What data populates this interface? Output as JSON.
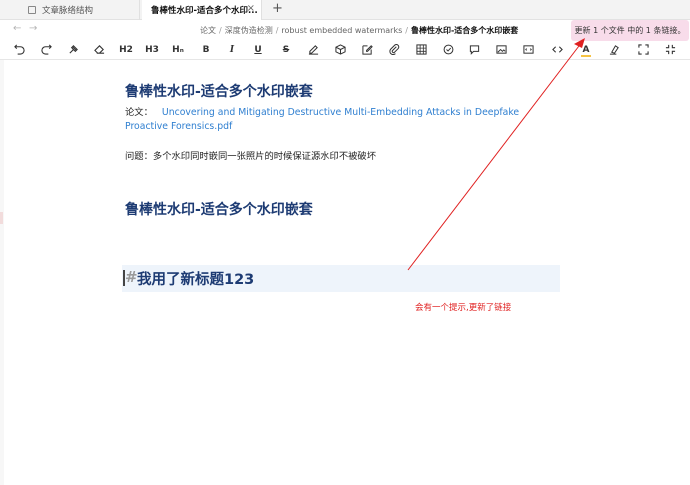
{
  "tabs": [
    {
      "label": "文章脉络结构"
    },
    {
      "label": "鲁棒性水印-适合多个水印..."
    }
  ],
  "tab_close": "×",
  "tab_add": "+",
  "nav": {
    "back": "←",
    "forward": "→"
  },
  "breadcrumb": {
    "items": [
      "论文",
      "深度伪造检测",
      "robust embedded watermarks"
    ],
    "current": "鲁棒性水印-适合多个水印嵌套",
    "separator": "/"
  },
  "notification": {
    "text": "更新 1 个文件 中的 1 条链接。"
  },
  "toolbar": {
    "h2": "H2",
    "h3": "H3",
    "hn": "Hₙ",
    "bold": "B",
    "italic": "I",
    "underline": "U",
    "strike": "S",
    "font_color": "A",
    "icons": [
      "undo-icon",
      "redo-icon",
      "format-painter-icon",
      "eraser-icon",
      "heading-2-icon",
      "heading-3-icon",
      "heading-n-icon",
      "bold-icon",
      "italic-icon",
      "underline-icon",
      "strikethrough-icon",
      "highlight-pen-icon",
      "cube-icon",
      "edit-icon",
      "attach-icon",
      "table-icon",
      "check-circle-icon",
      "comment-icon",
      "image-icon",
      "code-icon",
      "font-color-icon",
      "highlighter-icon",
      "fullscreen-icon",
      "collapse-icon"
    ],
    "font_color_swatch": "#f6c343"
  },
  "document": {
    "title": "鲁棒性水印-适合多个水印嵌套",
    "paper_label": "论文：",
    "paper_link": "Uncovering and Mitigating Destructive Multi-Embedding Attacks in Deepfake Proactive Forensics.pdf",
    "problem": "问题：多个水印同时嵌同一张照片的时候保证源水印不被破坏",
    "heading_repeat": "鲁棒性水印-适合多个水印嵌套",
    "new_heading_hash": "#",
    "new_heading": "我用了新标题123"
  },
  "annotation": {
    "text": "会有一个提示,更新了链接",
    "color": "#e02020"
  },
  "colors": {
    "heading": "#1d3b73",
    "link": "#2f7fd0",
    "notice_bg": "#f8dcea",
    "heading_box_bg": "#eef4fb"
  }
}
